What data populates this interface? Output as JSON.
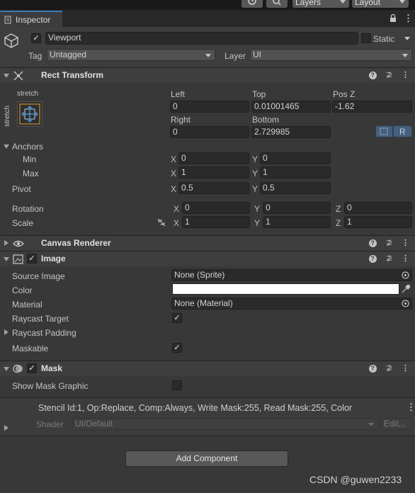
{
  "top_bar": {
    "layers": "Layers",
    "layout": "Layout"
  },
  "tab": {
    "label": "Inspector"
  },
  "object": {
    "name": "Viewport",
    "static_label": "Static",
    "tag_label": "Tag",
    "tag_value": "Untagged",
    "layer_label": "Layer",
    "layer_value": "UI"
  },
  "rect_transform": {
    "title": "Rect Transform",
    "anchor_preset_top": "stretch",
    "anchor_preset_side": "stretch",
    "left_label": "Left",
    "left_value": "0",
    "top_label": "Top",
    "top_value": "0.01001465",
    "posz_label": "Pos Z",
    "posz_value": "-1.62",
    "right_label": "Right",
    "right_value": "0",
    "bottom_label": "Bottom",
    "bottom_value": "2.729985",
    "r_button": "R",
    "anchors_label": "Anchors",
    "min_label": "Min",
    "min_x": "0",
    "min_y": "0",
    "max_label": "Max",
    "max_x": "1",
    "max_y": "1",
    "pivot_label": "Pivot",
    "pivot_x": "0.5",
    "pivot_y": "0.5",
    "rotation_label": "Rotation",
    "rot_x": "0",
    "rot_y": "0",
    "rot_z": "0",
    "scale_label": "Scale",
    "scale_x": "1",
    "scale_y": "1",
    "scale_z": "1",
    "x": "X",
    "y": "Y",
    "z": "Z"
  },
  "canvas_renderer": {
    "title": "Canvas Renderer"
  },
  "image": {
    "title": "Image",
    "source_image_label": "Source Image",
    "source_image_value": "None (Sprite)",
    "color_label": "Color",
    "color_value": "#ffffff",
    "material_label": "Material",
    "material_value": "None (Material)",
    "raycast_target_label": "Raycast Target",
    "raycast_target_checked": "✓",
    "raycast_padding_label": "Raycast Padding",
    "maskable_label": "Maskable",
    "maskable_checked": "✓"
  },
  "mask": {
    "title": "Mask",
    "show_mask_graphic_label": "Show Mask Graphic"
  },
  "material_preview": {
    "stencil_info": "Stencil Id:1, Op:Replace, Comp:Always, Write Mask:255, Read Mask:255, Color",
    "shader_label": "Shader",
    "shader_value": "UI/Default",
    "edit_label": "Edit..."
  },
  "add_component": {
    "label": "Add Component"
  },
  "watermark": "CSDN @guwen2233",
  "icons": [
    "history-icon",
    "search-icon",
    "lock-icon",
    "menu-icon",
    "gameobject-icon",
    "rect-transform-icon",
    "eye-icon",
    "image-icon",
    "mask-icon",
    "help-icon",
    "preset-icon",
    "unlink-icon",
    "eyedropper-icon",
    "object-picker-icon"
  ]
}
